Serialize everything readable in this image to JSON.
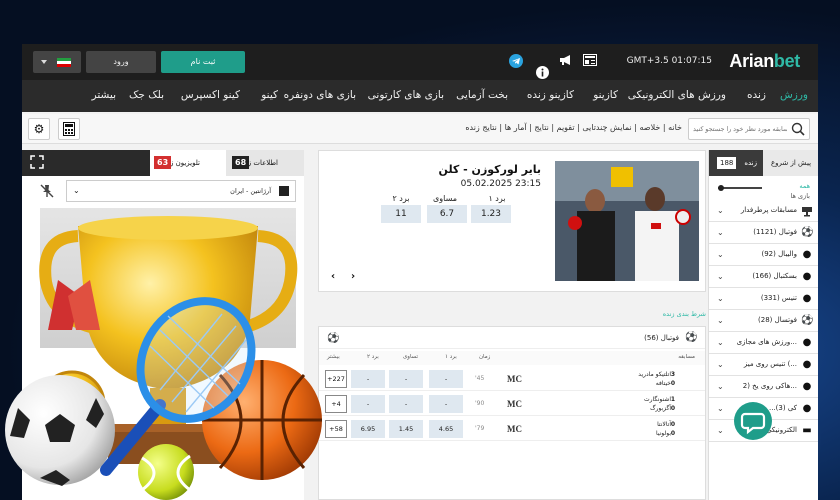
{
  "brand": {
    "name_a": "Arian",
    "name_b": "bet",
    "accent": "#2fb9a6"
  },
  "header": {
    "clock": "GMT+3.5  01:07:15",
    "register_label": "ثبت نام",
    "login_label": "ورود"
  },
  "nav": {
    "items": [
      "ورزش",
      "زنده",
      "ورزش های الکترونیکی",
      "کازینو",
      "کازینو زنده",
      "بخت آزمایی",
      "بازی های کارتونی",
      "بازی های دونفره",
      "کینو",
      "کینو اکسپرس",
      "بلک جک",
      "بیشتر"
    ]
  },
  "crumbs": {
    "text": "خانه | خلاصه | نمایش چندتایی | تقویم | نتایج | آمار ها | نتایج زنده",
    "search_placeholder": "مسابقه مورد نظر خود را جستجو کنید"
  },
  "sidebar": {
    "tab_prematch": "پیش از شروع",
    "tab_live": "زنده",
    "live_count": "188",
    "filter_label": "همه",
    "filter_sub": "بازی ها",
    "items": [
      {
        "label": "مسابقات پرطرفدار",
        "icon": "trophy-icon"
      },
      {
        "label": "فوتبال (1121)",
        "icon": "soccer-icon"
      },
      {
        "label": "والیبال (92)",
        "icon": "volleyball-icon"
      },
      {
        "label": "بسکتبال (166)",
        "icon": "basketball-icon"
      },
      {
        "label": "تنیس (331)",
        "icon": "tennis-icon"
      },
      {
        "label": "فوتسال (28)",
        "icon": "futsal-icon"
      },
      {
        "label": "ورزش های مجازی...",
        "icon": "virtual-icon"
      },
      {
        "label": "تنیس روی میز (...",
        "icon": "table-tennis-icon"
      },
      {
        "label": "هاکی روی یخ (2...",
        "icon": "hockey-icon"
      },
      {
        "label": "...کی (3)",
        "icon": "american-football-icon"
      },
      {
        "label": "...الکترونیکی",
        "icon": "esports-icon"
      }
    ]
  },
  "featured": {
    "title": "بایر لورکوزن - کلن",
    "date": "05.02.2025 23:15",
    "odds": [
      {
        "label": "برد ۱",
        "value": "1.23"
      },
      {
        "label": "مساوی",
        "value": "6.7"
      },
      {
        "label": "برد ۲",
        "value": "11"
      }
    ]
  },
  "live_table": {
    "section_label": "شرط بندی زنده",
    "sport": "فوتبال (56)",
    "columns": [
      "مسابقه",
      "زمان",
      "برد ۱",
      "تساوی",
      "برد ۲",
      "بیشتر"
    ],
    "rows": [
      {
        "home": "اتلتیکو مادرید",
        "away": "خیتافه",
        "hs": "3",
        "as": "0",
        "time": "'45",
        "w1": "-",
        "x": "-",
        "w2": "-",
        "more": "+227"
      },
      {
        "home": "اشنونگارت",
        "away": "آگزبورگ",
        "hs": "1",
        "as": "0",
        "time": "'90",
        "w1": "-",
        "x": "-",
        "w2": "-",
        "more": "+4"
      },
      {
        "home": "آتالانتا",
        "away": "بولونیا",
        "hs": "0",
        "as": "0",
        "time": "'79",
        "w1": "4.65",
        "x": "1.45",
        "w2": "6.95",
        "more": "+58"
      }
    ]
  },
  "live_panel": {
    "tab_info": "اطلاعات زنده",
    "tab_info_count": "68",
    "tab_tv": "تلویزیون زنده",
    "tab_tv_count": "63",
    "selected_match": "آرژانتین - ایران"
  }
}
